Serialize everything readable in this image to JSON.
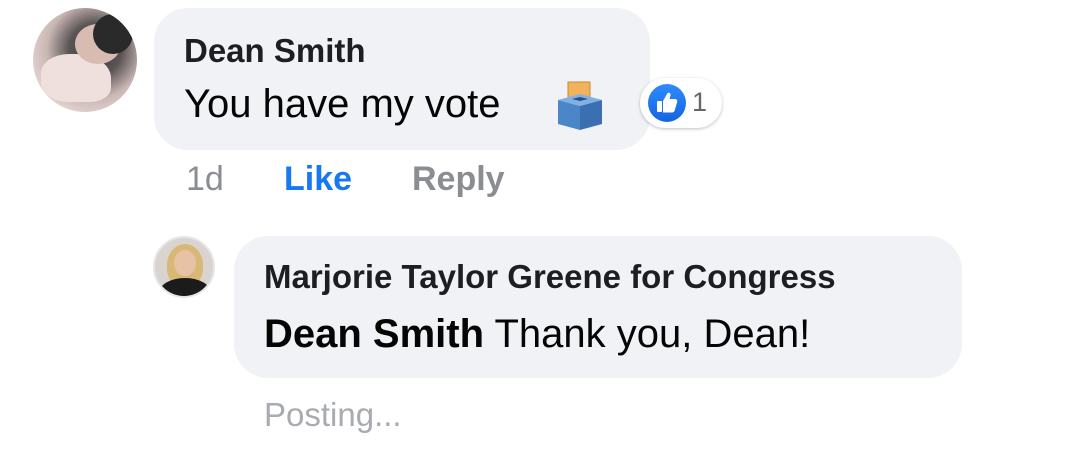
{
  "comment": {
    "author": "Dean Smith",
    "text": "You have my vote",
    "emoji": "ballot-box-icon",
    "reactions": {
      "type": "like",
      "count": "1"
    },
    "time": "1d",
    "like_label": "Like",
    "reply_label": "Reply"
  },
  "reply": {
    "author": "Marjorie Taylor Greene for Congress",
    "mention": "Dean Smith",
    "text": " Thank you, Dean!",
    "status": "Posting..."
  },
  "colors": {
    "bubble": "#f0f2f5",
    "like_blue": "#1877f2",
    "meta_gray": "#8a8d91"
  }
}
